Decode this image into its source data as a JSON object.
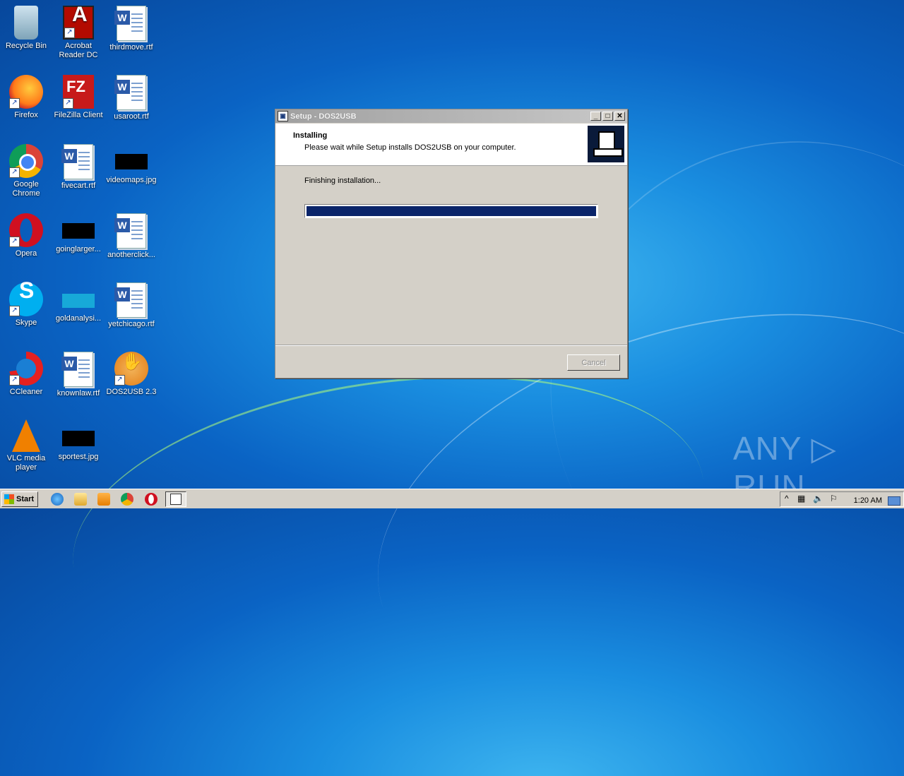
{
  "desktop": {
    "icons": [
      {
        "label": "Recycle Bin"
      },
      {
        "label": "Acrobat Reader DC"
      },
      {
        "label": "thirdmove.rtf"
      },
      {
        "label": "Firefox"
      },
      {
        "label": "FileZilla Client"
      },
      {
        "label": "usaroot.rtf"
      },
      {
        "label": "Google Chrome"
      },
      {
        "label": "fivecart.rtf"
      },
      {
        "label": "videomaps.jpg"
      },
      {
        "label": "Opera"
      },
      {
        "label": "goinglarger..."
      },
      {
        "label": "anotherclick..."
      },
      {
        "label": "Skype"
      },
      {
        "label": "goldanalysi..."
      },
      {
        "label": "yetchicago.rtf"
      },
      {
        "label": "CCleaner"
      },
      {
        "label": "knownlaw.rtf"
      },
      {
        "label": "DOS2USB 2.3"
      },
      {
        "label": "VLC media player"
      },
      {
        "label": "sportest.jpg"
      }
    ]
  },
  "dialog": {
    "title": "Setup - DOS2USB",
    "header_title": "Installing",
    "header_subtitle": "Please wait while Setup installs DOS2USB on your computer.",
    "status": "Finishing installation...",
    "progress_fraction": 1.0,
    "cancel_label": "Cancel",
    "minimize_glyph": "_",
    "maximize_glyph": "□",
    "close_glyph": "✕"
  },
  "taskbar": {
    "start_label": "Start",
    "clock": "1:20 AM",
    "tray_glyphs": {
      "overflow": "^",
      "network": "▦",
      "volume": "🔈",
      "flag": "⚐"
    }
  },
  "watermark": "ANY ▷ RUN",
  "colors": {
    "progress_fill": "#0a246a",
    "dialog_face": "#d4d0c8"
  }
}
